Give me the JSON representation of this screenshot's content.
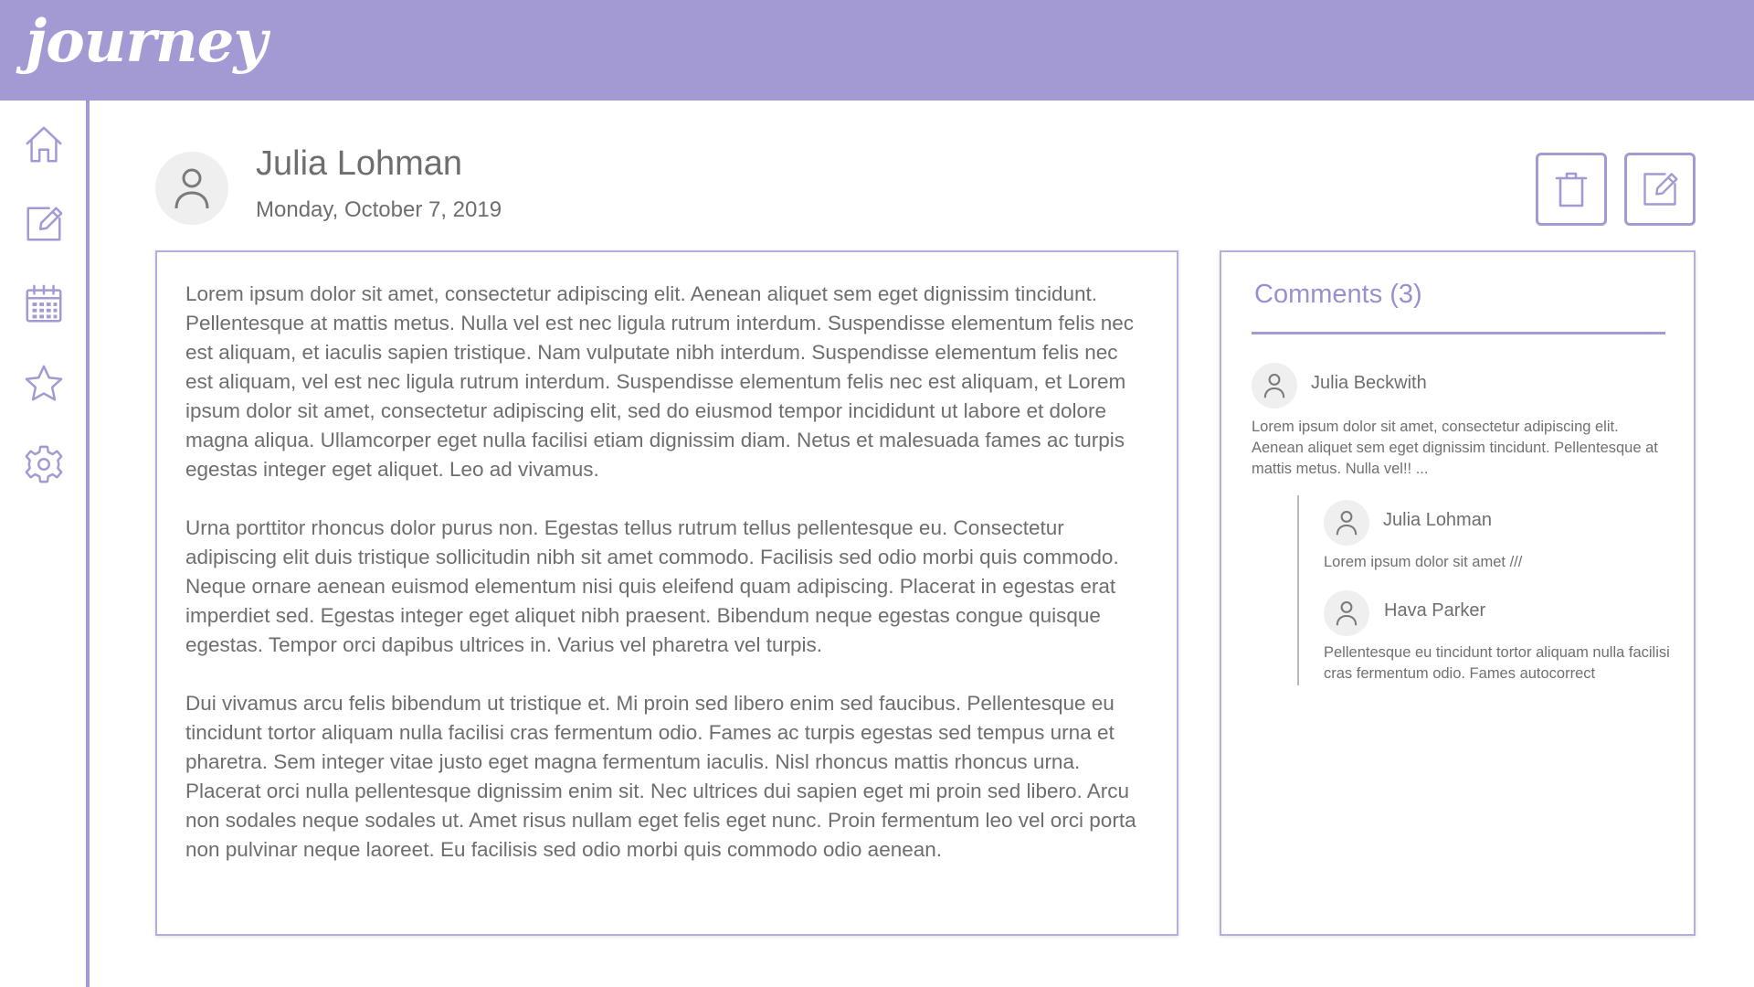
{
  "app": {
    "logo": "journey",
    "accent": "#a39ad4"
  },
  "sidebar": {
    "items": [
      {
        "name": "home",
        "icon": "home-icon"
      },
      {
        "name": "new-entry",
        "icon": "edit-icon"
      },
      {
        "name": "calendar",
        "icon": "calendar-icon"
      },
      {
        "name": "favorites",
        "icon": "star-icon"
      },
      {
        "name": "settings",
        "icon": "gear-icon"
      }
    ]
  },
  "entry": {
    "author": "Julia Lohman",
    "date": "Monday, October 7, 2019",
    "paragraphs": [
      "Lorem ipsum dolor sit amet, consectetur adipiscing elit. Aenean aliquet sem eget dignissim tincidunt. Pellentesque at mattis metus. Nulla vel est nec ligula rutrum interdum. Suspendisse elementum felis nec est aliquam, et iaculis sapien tristique. Nam vulputate nibh interdum. Suspendisse elementum felis nec est aliquam, vel est nec ligula rutrum interdum. Suspendisse elementum felis nec est aliquam, et Lorem ipsum dolor sit amet, consectetur adipiscing elit, sed do eiusmod tempor incididunt ut labore et dolore magna aliqua. Ullamcorper eget nulla facilisi etiam dignissim diam. Netus et malesuada fames ac turpis egestas integer eget aliquet. Leo ad vivamus.",
      "Urna porttitor rhoncus dolor purus non. Egestas tellus rutrum tellus pellentesque eu. Consectetur adipiscing elit duis tristique sollicitudin nibh sit amet commodo. Facilisis sed odio morbi quis commodo. Neque ornare aenean euismod elementum nisi quis eleifend quam adipiscing. Placerat in egestas erat imperdiet sed. Egestas integer eget aliquet nibh praesent. Bibendum neque egestas congue quisque egestas. Tempor orci dapibus ultrices in. Varius vel pharetra vel turpis.",
      "Dui vivamus arcu felis bibendum ut tristique et. Mi proin sed libero enim sed faucibus. Pellentesque eu tincidunt tortor aliquam nulla facilisi cras fermentum odio. Fames ac turpis egestas sed tempus urna et pharetra. Sem integer vitae justo eget magna fermentum iaculis. Nisl rhoncus mattis rhoncus urna. Placerat orci nulla pellentesque dignissim enim sit. Nec ultrices dui sapien eget mi proin sed libero. Arcu non sodales neque sodales ut. Amet risus nullam eget felis eget nunc. Proin fermentum leo vel orci porta non pulvinar neque laoreet. Eu facilisis sed odio morbi quis commodo odio aenean."
    ]
  },
  "actions": {
    "delete_icon": "trash-icon",
    "edit_icon": "edit-icon"
  },
  "comments": {
    "title": "Comments (3)",
    "items": [
      {
        "author": "Julia Beckwith",
        "text": "Lorem ipsum dolor sit amet, consectetur adipiscing elit. Aenean aliquet sem eget dignissim tincidunt. Pellentesque at mattis metus. Nulla vel!! ...",
        "replies": [
          {
            "author": "Julia Lohman",
            "text": "Lorem ipsum dolor sit amet ///"
          },
          {
            "author": "Hava Parker",
            "text": "Pellentesque eu tincidunt tortor aliquam nulla facilisi cras fermentum odio. Fames autocorrect"
          }
        ]
      }
    ]
  }
}
